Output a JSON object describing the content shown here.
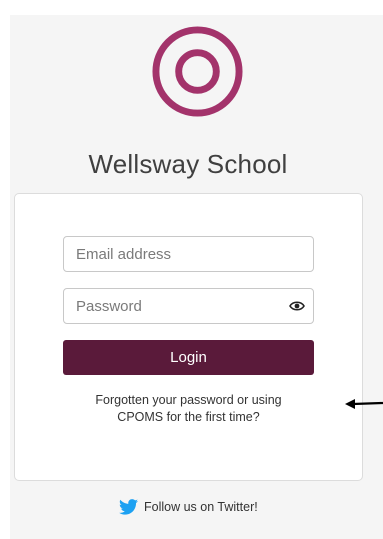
{
  "school": {
    "name": "Wellsway School"
  },
  "form": {
    "email_placeholder": "Email address",
    "password_placeholder": "Password",
    "login_label": "Login",
    "forgot_line1": "Forgotten your password or using",
    "forgot_line2": "CPOMS for the first time?"
  },
  "footer": {
    "twitter_label": "Follow us on Twitter!"
  },
  "icons": {
    "logo": "ring-logo-icon",
    "password_toggle": "eye-icon",
    "annotation": "arrow-left-icon",
    "social": "twitter-bird-icon"
  },
  "colors": {
    "brand": "#a3336b",
    "button": "#5a1a3a",
    "twitter": "#1da1f2"
  }
}
